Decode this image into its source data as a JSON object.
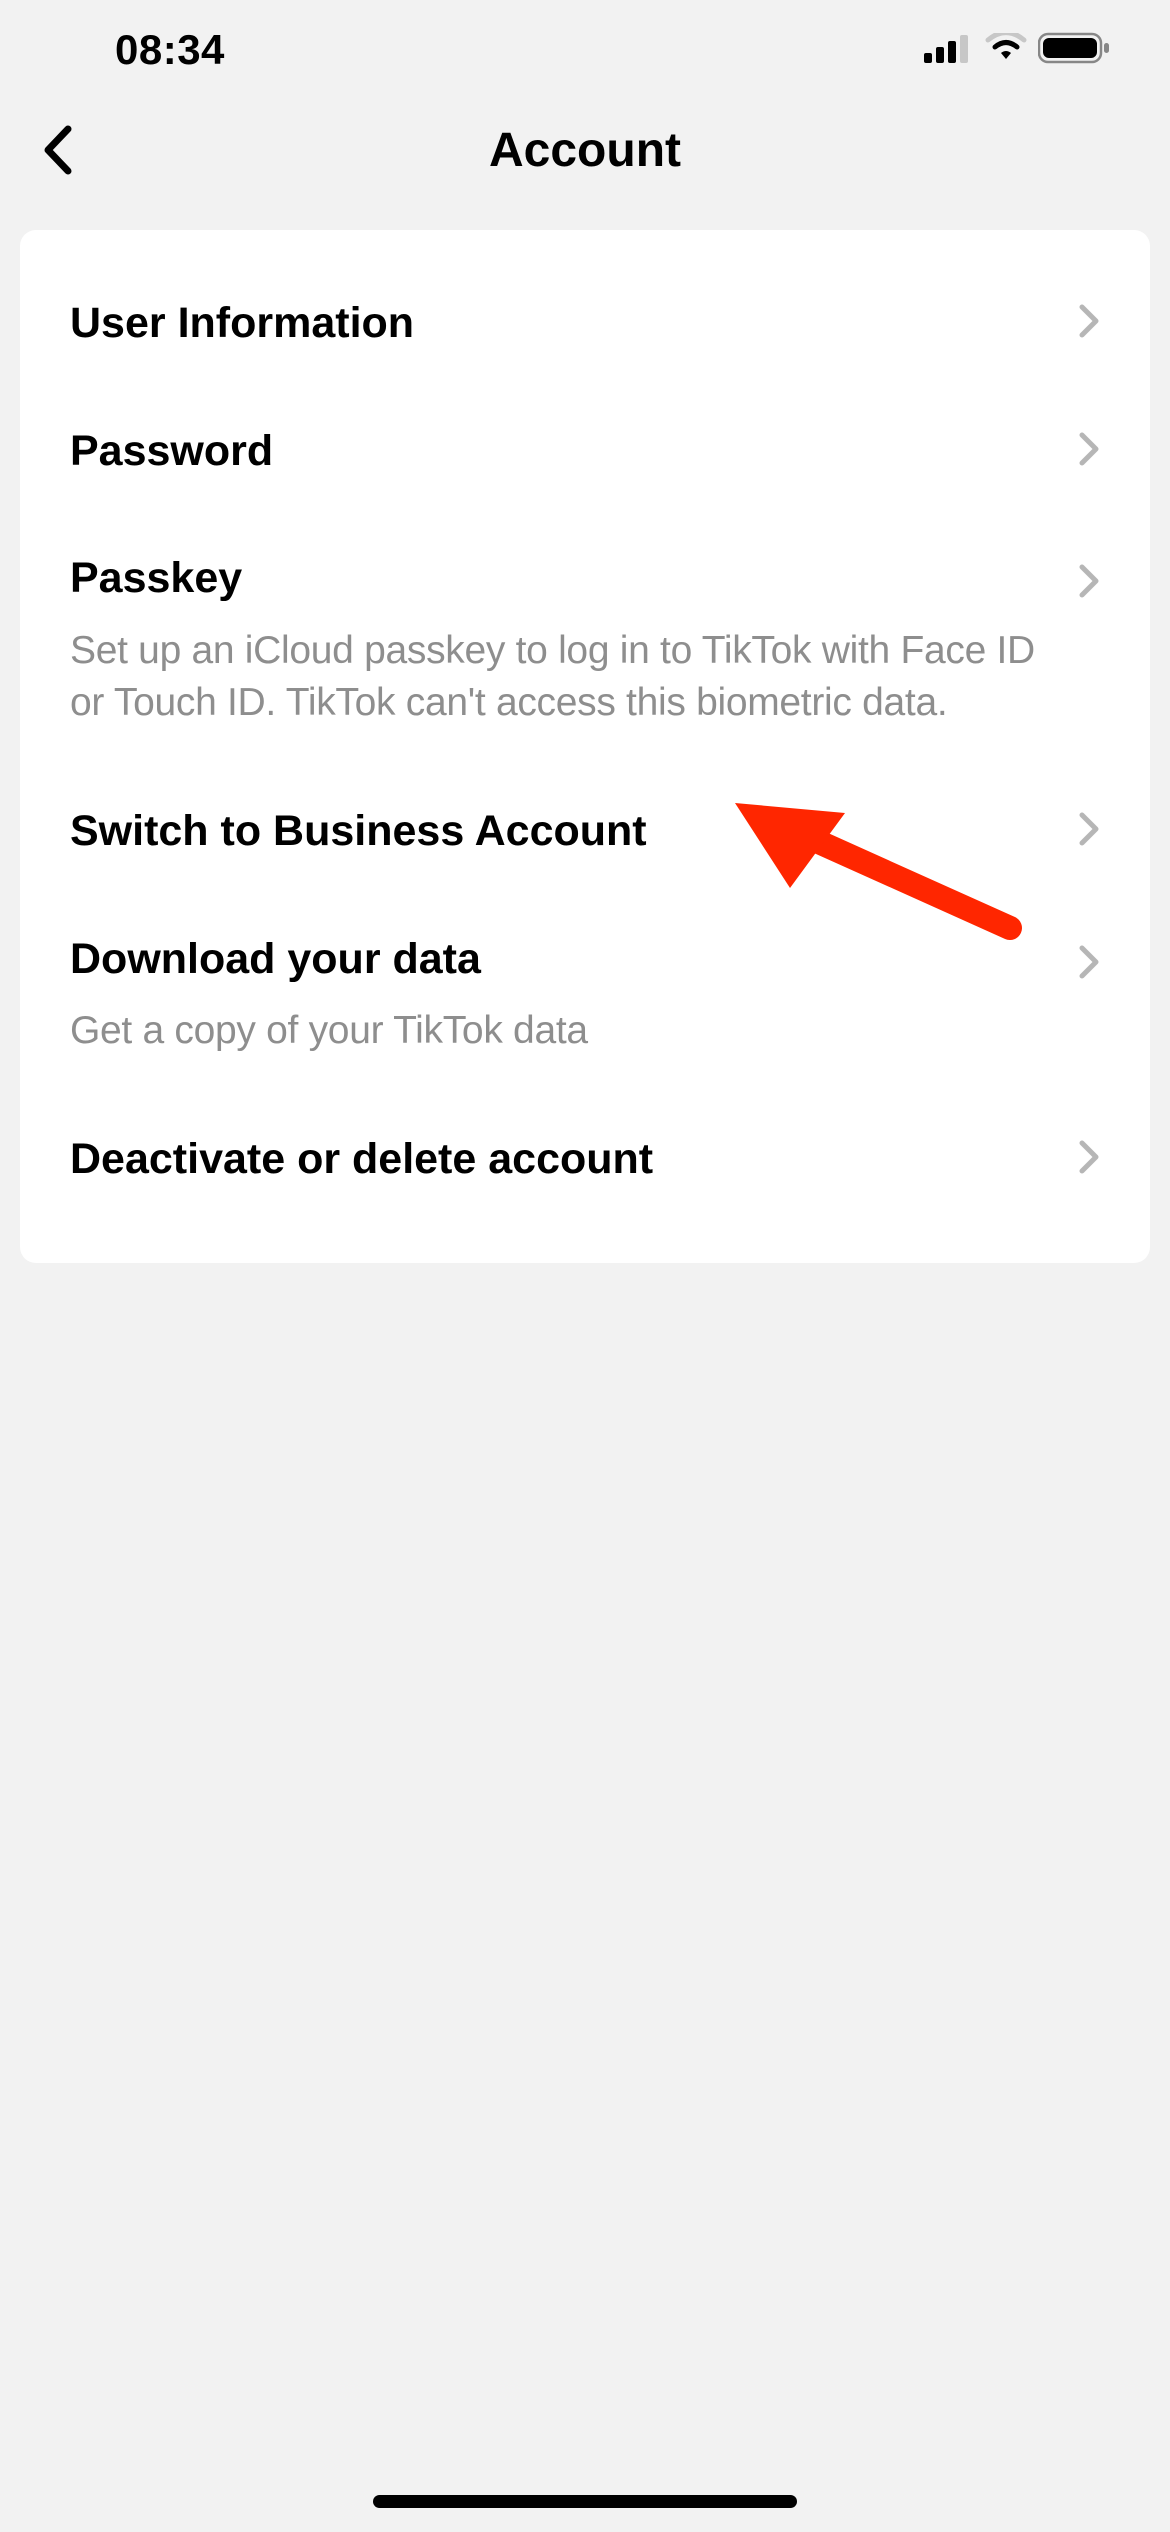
{
  "status_bar": {
    "time": "08:34"
  },
  "header": {
    "title": "Account"
  },
  "menu": {
    "items": [
      {
        "label": "User Information",
        "description": null
      },
      {
        "label": "Password",
        "description": null
      },
      {
        "label": "Passkey",
        "description": "Set up an iCloud passkey to log in to TikTok with Face ID or Touch ID. TikTok can't access this biometric data."
      },
      {
        "label": "Switch to Business Account",
        "description": null
      },
      {
        "label": "Download your data",
        "description": "Get a copy of your TikTok data"
      },
      {
        "label": "Deactivate or delete account",
        "description": null
      }
    ]
  },
  "annotation": {
    "type": "arrow",
    "color": "#ff2600",
    "target_item_index": 3
  }
}
